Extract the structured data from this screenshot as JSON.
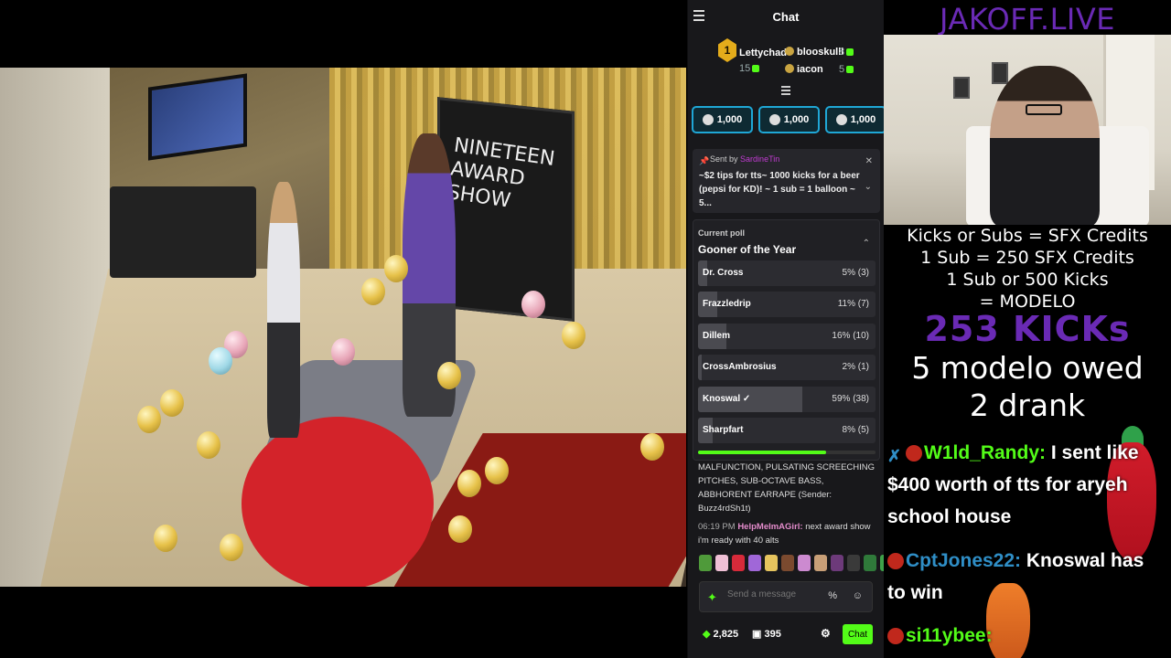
{
  "chat": {
    "title": "Chat",
    "leaderboard": {
      "rank1": {
        "rank": "1",
        "name": "Lettychad",
        "count": "15"
      },
      "rank2": {
        "name": "blooskulll",
        "count": "8"
      },
      "rank3": {
        "name": "iacon",
        "count": "5"
      }
    },
    "gifts": [
      {
        "label": "1,000"
      },
      {
        "label": "1,000"
      },
      {
        "label": "1,000"
      }
    ],
    "pinned": {
      "sent_by": "Sent by",
      "sender": "SardineTin",
      "message": "~$2 tips for tts~ 1000 kicks for a beer (pepsi for KD)! ~ 1 sub = 1 balloon ~ 5..."
    },
    "poll": {
      "label": "Current poll",
      "question": "Gooner of the Year",
      "options": [
        {
          "name": "Dr. Cross",
          "pct": "5% (3)",
          "fraction": 0.05
        },
        {
          "name": "Frazzledrip",
          "pct": "11% (7)",
          "fraction": 0.11
        },
        {
          "name": "Dillem",
          "pct": "16% (10)",
          "fraction": 0.16
        },
        {
          "name": "CrossAmbrosius",
          "pct": "2% (1)",
          "fraction": 0.02
        },
        {
          "name": "Knoswal ✓",
          "pct": "59% (38)",
          "fraction": 0.59
        },
        {
          "name": "Sharpfart",
          "pct": "8% (5)",
          "fraction": 0.08
        }
      ],
      "time_remaining_fraction": 0.72
    },
    "messages": {
      "m1_text": "MALFUNCTION, PULSATING SCREECHING PITCHES, SUB-OCTAVE BASS, ABBHORENT EARRAPE (Sender: Buzz4rdSh1t)",
      "m2_time": "06:19 PM",
      "m2_user": "HelpMeImAGirl:",
      "m2_text": "next award show i'm ready with 40 alts"
    },
    "input": {
      "placeholder": "Send a message"
    },
    "bottom": {
      "points": "2,825",
      "gift_count": "395",
      "chat_button": "Chat"
    }
  },
  "overlay": {
    "brand": "JAKOFF.LIVE",
    "info_lines": [
      "Kicks or Subs = SFX Credits",
      "1 Sub = 250 SFX Credits",
      "1 Sub or 500 Kicks",
      "= MODELO"
    ],
    "kicks": "253 KICKs",
    "owed": "5 modelo owed",
    "drank": "2 drank",
    "chat": [
      {
        "user": "W1ld_Randy:",
        "text": "I sent like $400 worth of tts for aryeh school house"
      },
      {
        "user": "CptJones22:",
        "text": "Knoswal has to win"
      },
      {
        "user": "si11ybee:",
        "text": ""
      }
    ]
  },
  "camera": {
    "board_text": "NINETEEN AWARD SHOW"
  },
  "colors": {
    "kick_green": "#53fc18",
    "brand_purple": "#6a2ab5",
    "chat_bg": "#18181b"
  }
}
